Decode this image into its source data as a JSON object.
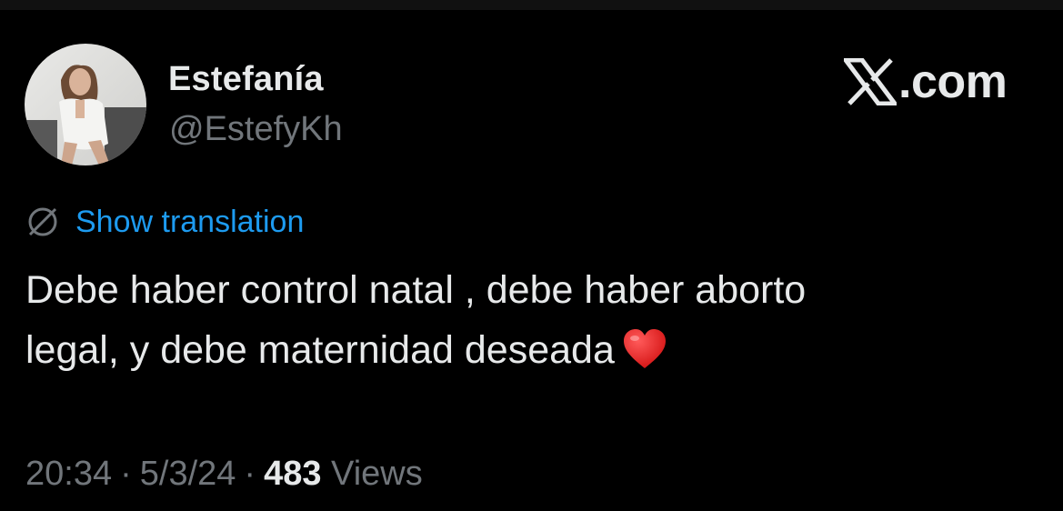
{
  "tweet": {
    "author": {
      "display_name": "Estefanía",
      "handle": "@EstefyKh",
      "avatar_icon": "profile-photo"
    },
    "brand": {
      "logo_icon": "x-logo-icon",
      "text": ".com"
    },
    "translation": {
      "icon": "translate-globe-icon",
      "label": "Show translation",
      "color": "#1d9bf0"
    },
    "text": {
      "line1": "Debe haber control natal , debe haber aborto",
      "line2": "legal, y debe maternidad deseada",
      "emoji_icon": "red-heart-icon"
    },
    "meta": {
      "time": "20:34",
      "separator": "·",
      "date": "5/3/24",
      "views_count": "483",
      "views_label": "Views"
    }
  },
  "colors": {
    "background": "#000000",
    "text_primary": "#e7e9ea",
    "text_secondary": "#71767b",
    "link": "#1d9bf0"
  }
}
